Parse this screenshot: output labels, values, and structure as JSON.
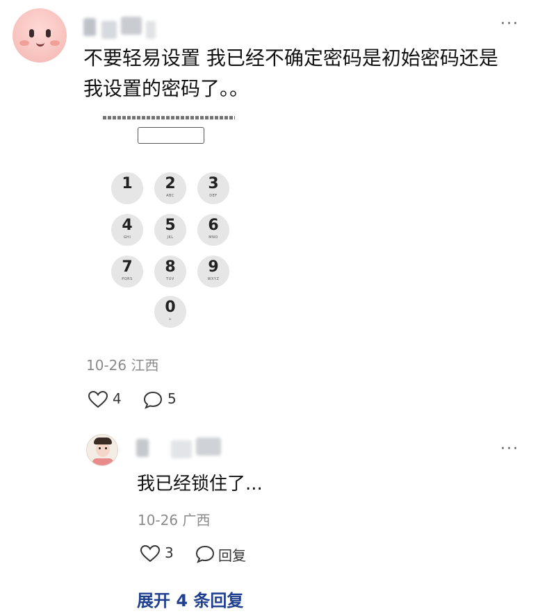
{
  "comment": {
    "text_line1": "不要轻易设置 我已经不确定密码是初始密码还是",
    "text_line2": "我设置的密码了。。",
    "more": "···",
    "date": "10-26",
    "location": "江西",
    "likes": "4",
    "replies": "5"
  },
  "pin_screen": {
    "keys": [
      {
        "num": "1",
        "sub": ""
      },
      {
        "num": "2",
        "sub": "ABC"
      },
      {
        "num": "3",
        "sub": "DEF"
      },
      {
        "num": "4",
        "sub": "GHI"
      },
      {
        "num": "5",
        "sub": "JKL"
      },
      {
        "num": "6",
        "sub": "MNO"
      },
      {
        "num": "7",
        "sub": "PQRS"
      },
      {
        "num": "8",
        "sub": "TUV"
      },
      {
        "num": "9",
        "sub": "WXYZ"
      },
      {
        "num": "0",
        "sub": "+"
      }
    ]
  },
  "reply": {
    "text": "我已经锁住了...",
    "more": "···",
    "date": "10-26",
    "location": "广西",
    "likes": "3",
    "reply_label": "回复"
  },
  "expand_label": "展开 4 条回复"
}
